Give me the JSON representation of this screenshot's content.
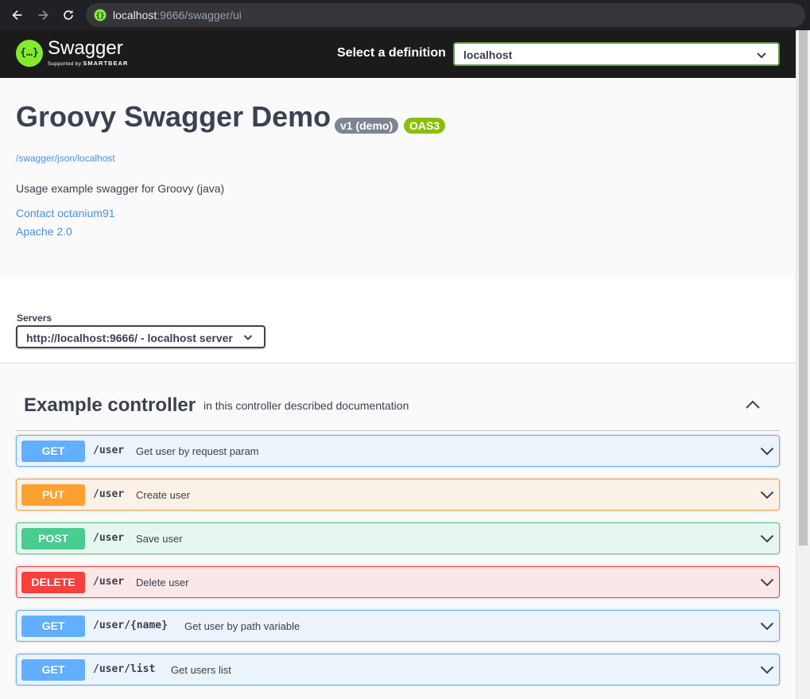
{
  "browser": {
    "url_host": "localhost",
    "url_rest": ":9666/swagger/ui"
  },
  "topbar": {
    "logo_word": "Swagger",
    "logo_sub_prefix": "Supported by",
    "logo_sub_brand": "SMARTBEAR",
    "logo_mark": "{…}",
    "definition_label": "Select a definition",
    "definition_value": "localhost"
  },
  "info": {
    "title": "Groovy Swagger Demo",
    "version_badge": "v1 (demo)",
    "oas_badge": "OAS3",
    "spec_url": "/swagger/json/localhost",
    "description": "Usage example swagger for Groovy (java)",
    "contact": "Contact octanium91",
    "license": "Apache 2.0"
  },
  "servers": {
    "label": "Servers",
    "selected": "http://localhost:9666/ - localhost server"
  },
  "tag": {
    "name": "Example controller",
    "description": "in this controller described documentation"
  },
  "operations": [
    {
      "method": "GET",
      "path": "/user",
      "summary": "Get user by request param"
    },
    {
      "method": "PUT",
      "path": "/user",
      "summary": "Create user"
    },
    {
      "method": "POST",
      "path": "/user",
      "summary": "Save user"
    },
    {
      "method": "DELETE",
      "path": "/user",
      "summary": "Delete user"
    },
    {
      "method": "GET",
      "path": "/user/{name}",
      "summary": "Get user by path variable"
    },
    {
      "method": "GET",
      "path": "/user/list",
      "summary": "Get users list"
    }
  ],
  "colors": {
    "get": "#61affe",
    "put": "#fca130",
    "post": "#49cc90",
    "delete": "#f93e3e",
    "swagger_green": "#85ea2d",
    "link": "#4990e2"
  }
}
